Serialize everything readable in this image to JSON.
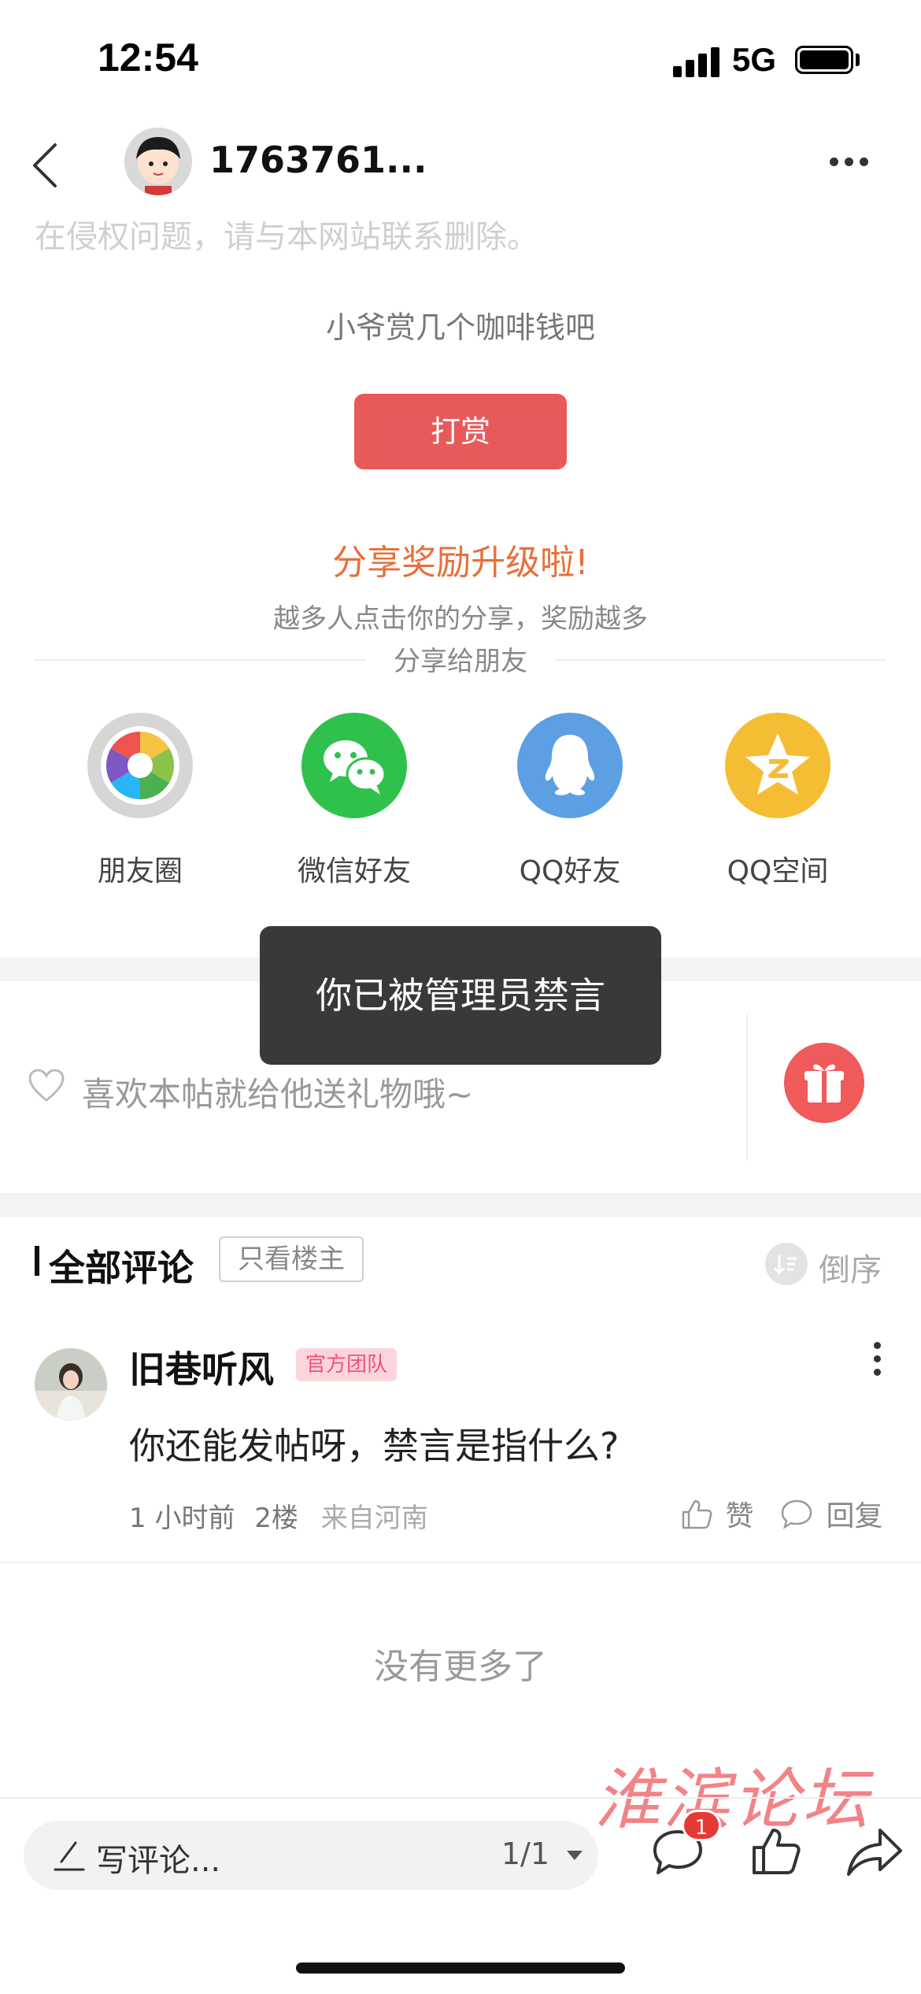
{
  "status_bar": {
    "time": "12:54",
    "network": "5G"
  },
  "header": {
    "username": "1763761...",
    "back_icon": "chevron-left-icon",
    "more_icon": "more-horizontal-icon"
  },
  "post": {
    "faded_text": "在侵权问题，请与本网站联系删除。"
  },
  "tip": {
    "prompt": "小爷赏几个咖啡钱吧",
    "button_label": "打赏",
    "button_color": "#e85a5a"
  },
  "share": {
    "title": "分享奖励升级啦!",
    "subtitle": "越多人点击你的分享，奖励越多",
    "friends_label": "分享给朋友",
    "targets": [
      {
        "label": "朋友圈",
        "icon": "moments-icon"
      },
      {
        "label": "微信好友",
        "icon": "wechat-icon"
      },
      {
        "label": "QQ好友",
        "icon": "qq-icon"
      },
      {
        "label": "QQ空间",
        "icon": "qzone-icon"
      }
    ]
  },
  "gift": {
    "text": "喜欢本帖就给他送礼物哦~",
    "icon": "gift-icon"
  },
  "toast": {
    "message": "你已被管理员禁言"
  },
  "comments": {
    "title": "全部评论",
    "only_op_label": "只看楼主",
    "sort_label": "倒序",
    "items": [
      {
        "name": "旧巷听风",
        "badge": "官方团队",
        "text": "你还能发帖呀，禁言是指什么?",
        "time": "1 小时前",
        "floor": "2楼",
        "from": "来自河南",
        "like_label": "赞",
        "reply_label": "回复"
      }
    ],
    "no_more": "没有更多了"
  },
  "watermark": "淮滨论坛",
  "bottom_bar": {
    "input_placeholder": "写评论...",
    "page_indicator": "1/1",
    "comment_count": "1"
  }
}
